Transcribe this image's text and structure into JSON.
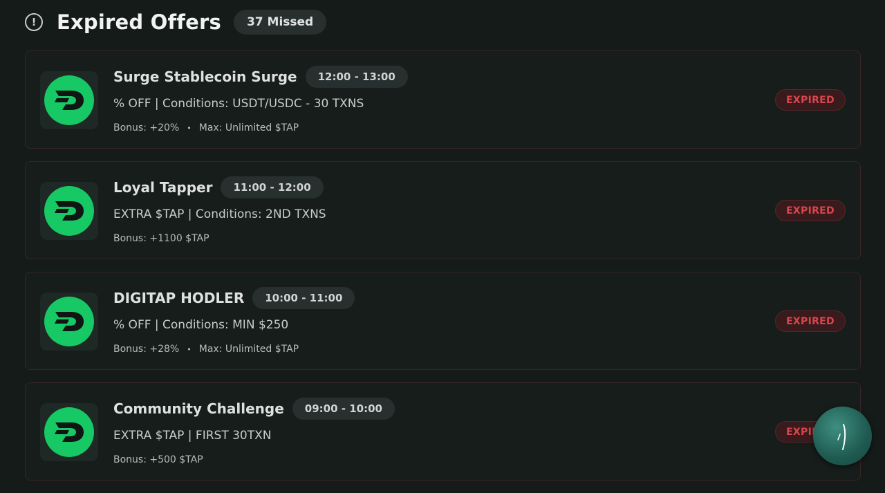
{
  "header": {
    "title": "Expired Offers",
    "missed_badge": "37 Missed",
    "icon": "exclamation-circle-icon"
  },
  "colors": {
    "background": "#141b18",
    "brand_green": "#17c964",
    "expired_red": "#d9464c"
  },
  "offers": [
    {
      "title": "Surge Stablecoin Surge",
      "time": "12:00 - 13:00",
      "description": "% OFF | Conditions: USDT/USDC - 30 TXNS",
      "bonus": "Bonus: +20%",
      "max": "Max: Unlimited $TAP",
      "status": "EXPIRED"
    },
    {
      "title": "Loyal Tapper",
      "time": "11:00 - 12:00",
      "description": "EXTRA $TAP | Conditions: 2ND TXNS",
      "bonus": "Bonus: +1100 $TAP",
      "max": "",
      "status": "EXPIRED"
    },
    {
      "title": "DIGITAP HODLER",
      "time": "10:00 - 11:00",
      "description": "% OFF | Conditions: MIN $250",
      "bonus": "Bonus: +28%",
      "max": "Max: Unlimited $TAP",
      "status": "EXPIRED"
    },
    {
      "title": "Community Challenge",
      "time": "09:00 - 10:00",
      "description": "EXTRA $TAP | FIRST 30TXN",
      "bonus": "Bonus: +500 $TAP",
      "max": "",
      "status": "EXPIRED"
    }
  ],
  "floating_button": {
    "icon": "chat-bubble-icon"
  }
}
